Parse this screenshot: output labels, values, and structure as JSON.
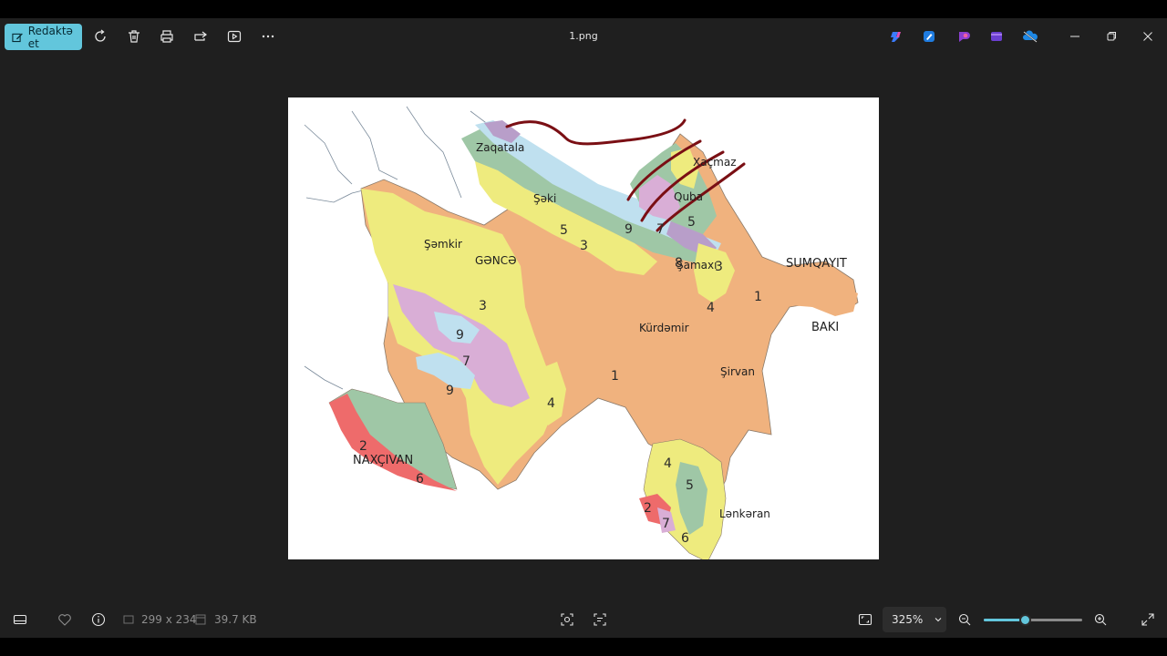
{
  "toolbar": {
    "edit_label": "Redaktə et",
    "icons": [
      "edit-icon",
      "rotate-icon",
      "delete-icon",
      "print-icon",
      "share-icon",
      "slideshow-icon",
      "more-icon"
    ]
  },
  "window": {
    "title": "1.png",
    "app_icons": [
      "copilot-icon",
      "designer-icon",
      "clipchamp-icon",
      "video-icon",
      "onedrive-icon"
    ],
    "controls": [
      "minimize-icon",
      "restore-icon",
      "close-icon"
    ]
  },
  "map": {
    "cities": {
      "zaqatala": "Zaqatala",
      "xacmaz": "Xaçmaz",
      "quba": "Quba",
      "seki": "Şəki",
      "samkir": "Şəmkir",
      "gence": "GƏNCƏ",
      "samaxi": "Şamaxı",
      "sumqayit": "SUMQAYIT",
      "baki": "BAKI",
      "kurdemir": "Kürdəmir",
      "sirvan": "Şirvan",
      "naxcivan": "NAXÇIVAN",
      "lenkeran": "Lənkəran"
    },
    "zones": [
      "1",
      "2",
      "3",
      "4",
      "5",
      "6",
      "7",
      "8",
      "9"
    ]
  },
  "status": {
    "dimensions": "299 x 234",
    "file_size": "39.7 KB",
    "zoom": "325%",
    "zoom_fraction": 0.42
  },
  "colors": {
    "accent": "#62c6dc",
    "zone_orange": "#f0b27e",
    "zone_yellow": "#eeeb7e",
    "zone_green": "#9fc7a6",
    "zone_pink": "#d9aed6",
    "zone_lightblue": "#bfe0ef",
    "zone_purple": "#b89ec9",
    "zone_red": "#ee6b6b",
    "annotation_stroke": "#7a0f14"
  }
}
